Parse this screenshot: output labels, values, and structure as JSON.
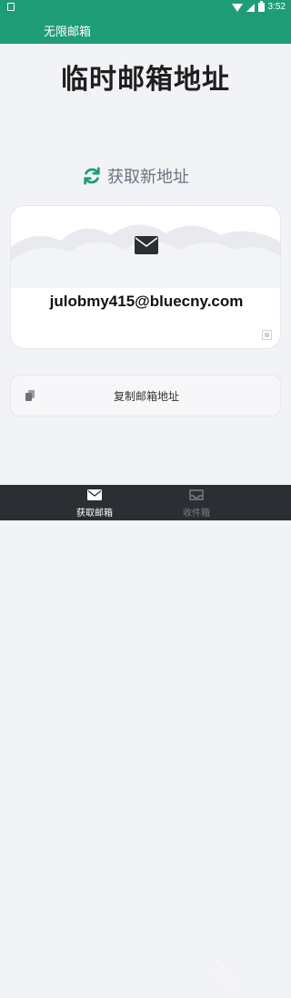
{
  "status_bar": {
    "time": "3:52",
    "battery": "8"
  },
  "app_bar": {
    "title": "无限邮箱"
  },
  "main": {
    "heading": "临时邮箱地址",
    "refresh_label": "获取新地址",
    "email_address": "julobmy415@bluecny.com",
    "copy_label": "复制邮箱地址"
  },
  "bottom_nav": {
    "items": [
      {
        "label": "获取邮箱",
        "icon": "mail-icon",
        "active": true
      },
      {
        "label": "收件箱",
        "icon": "inbox-icon",
        "active": false
      }
    ]
  },
  "watermark": "下载",
  "colors": {
    "primary": "#1f9d77",
    "nav_bg": "#2b2e33",
    "bg": "#f2f3f6"
  }
}
